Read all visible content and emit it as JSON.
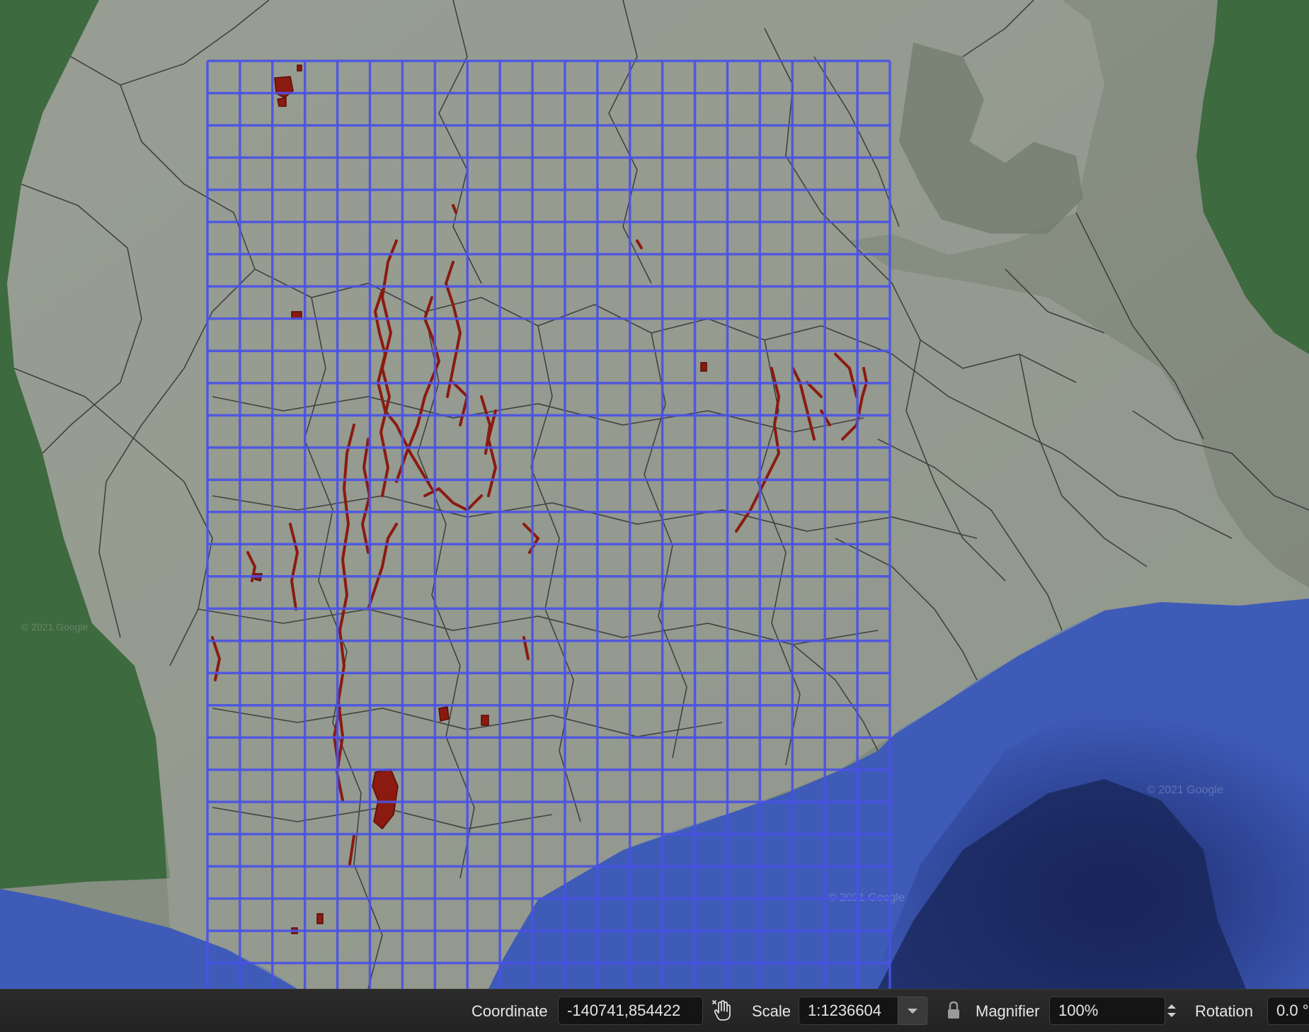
{
  "map": {
    "basemap": "satellite imagery",
    "colors": {
      "grid": "#4a52e6",
      "highlight": "#8b1a10",
      "boundary": "#2d2d2d",
      "overlay": "#9aa096",
      "sea": "#3e5bb8",
      "forest": "#2f5a33"
    },
    "watermarks": [
      "© 2021 Google",
      "© 2021 Google",
      "© 2021 Google"
    ]
  },
  "statusbar": {
    "coordinate_label": "Coordinate",
    "coordinate_value": "-140741,854422",
    "scale_label": "Scale",
    "scale_value": "1:1236604",
    "magnifier_label": "Magnifier",
    "magnifier_value": "100%",
    "rotation_label": "Rotation",
    "rotation_value": "0.0 °",
    "icons": [
      "pan-hand-icon",
      "lock-icon",
      "dropdown-arrow-icon",
      "spinner-arrows-icon"
    ]
  }
}
